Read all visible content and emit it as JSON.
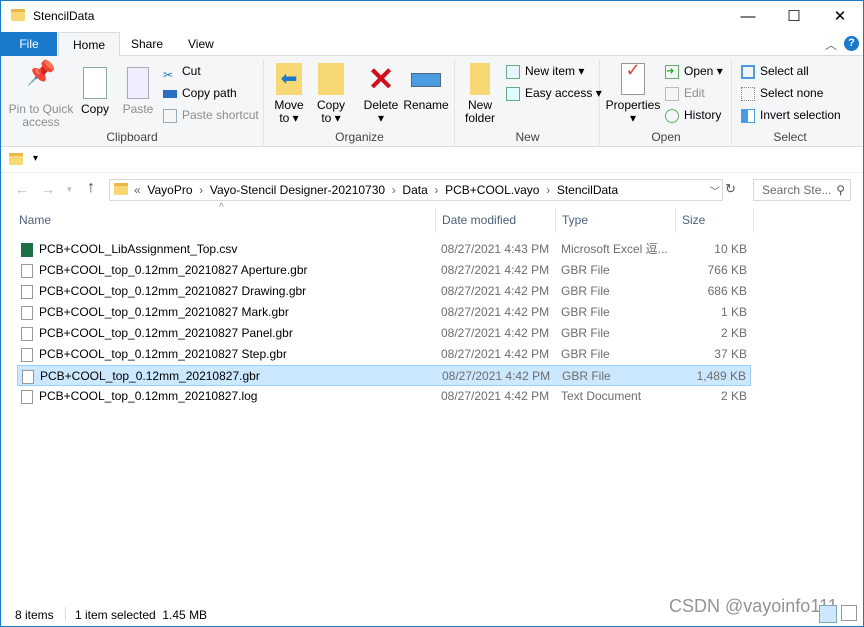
{
  "window": {
    "title": "StencilData",
    "minimize": "—",
    "maximize": "☐",
    "close": "✕"
  },
  "ribbon_tabs": [
    {
      "label": "File"
    },
    {
      "label": "Home"
    },
    {
      "label": "Share"
    },
    {
      "label": "View"
    }
  ],
  "ribbon": {
    "clipboard": {
      "label": "Clipboard",
      "pin": "Pin to Quick access",
      "copy": "Copy",
      "paste": "Paste",
      "cut": "Cut",
      "copy_path": "Copy path",
      "paste_shortcut": "Paste shortcut"
    },
    "organize": {
      "label": "Organize",
      "move_to": "Move to",
      "copy_to": "Copy to",
      "delete": "Delete",
      "rename": "Rename"
    },
    "new": {
      "label": "New",
      "new_folder": "New folder",
      "new_item": "New item",
      "easy_access": "Easy access"
    },
    "open": {
      "label": "Open",
      "properties": "Properties",
      "open": "Open",
      "edit": "Edit",
      "history": "History"
    },
    "select": {
      "label": "Select",
      "select_all": "Select all",
      "select_none": "Select none",
      "invert": "Invert selection"
    }
  },
  "address": {
    "crumbs": [
      "VayoPro",
      "Vayo-Stencil Designer-20210730",
      "Data",
      "PCB+COOL.vayo",
      "StencilData"
    ],
    "search_placeholder": "Search Ste..."
  },
  "columns": {
    "name": "Name",
    "date": "Date modified",
    "type": "Type",
    "size": "Size"
  },
  "files": [
    {
      "name": "PCB+COOL_LibAssignment_Top.csv",
      "date": "08/27/2021 4:43 PM",
      "type": "Microsoft Excel 逗...",
      "size": "10 KB",
      "icon": "excel"
    },
    {
      "name": "PCB+COOL_top_0.12mm_20210827 Aperture.gbr",
      "date": "08/27/2021 4:42 PM",
      "type": "GBR File",
      "size": "766 KB",
      "icon": "file"
    },
    {
      "name": "PCB+COOL_top_0.12mm_20210827 Drawing.gbr",
      "date": "08/27/2021 4:42 PM",
      "type": "GBR File",
      "size": "686 KB",
      "icon": "file"
    },
    {
      "name": "PCB+COOL_top_0.12mm_20210827 Mark.gbr",
      "date": "08/27/2021 4:42 PM",
      "type": "GBR File",
      "size": "1 KB",
      "icon": "file"
    },
    {
      "name": "PCB+COOL_top_0.12mm_20210827 Panel.gbr",
      "date": "08/27/2021 4:42 PM",
      "type": "GBR File",
      "size": "2 KB",
      "icon": "file"
    },
    {
      "name": "PCB+COOL_top_0.12mm_20210827 Step.gbr",
      "date": "08/27/2021 4:42 PM",
      "type": "GBR File",
      "size": "37 KB",
      "icon": "file"
    },
    {
      "name": "PCB+COOL_top_0.12mm_20210827.gbr",
      "date": "08/27/2021 4:42 PM",
      "type": "GBR File",
      "size": "1,489 KB",
      "icon": "file",
      "selected": true
    },
    {
      "name": "PCB+COOL_top_0.12mm_20210827.log",
      "date": "08/27/2021 4:42 PM",
      "type": "Text Document",
      "size": "2 KB",
      "icon": "text"
    }
  ],
  "status": {
    "items": "8 items",
    "selected": "1 item selected  1.45 MB"
  },
  "watermark": "CSDN @vayoinfo111",
  "colors": {
    "accent": "#1979ca",
    "selection": "#cce8ff"
  }
}
